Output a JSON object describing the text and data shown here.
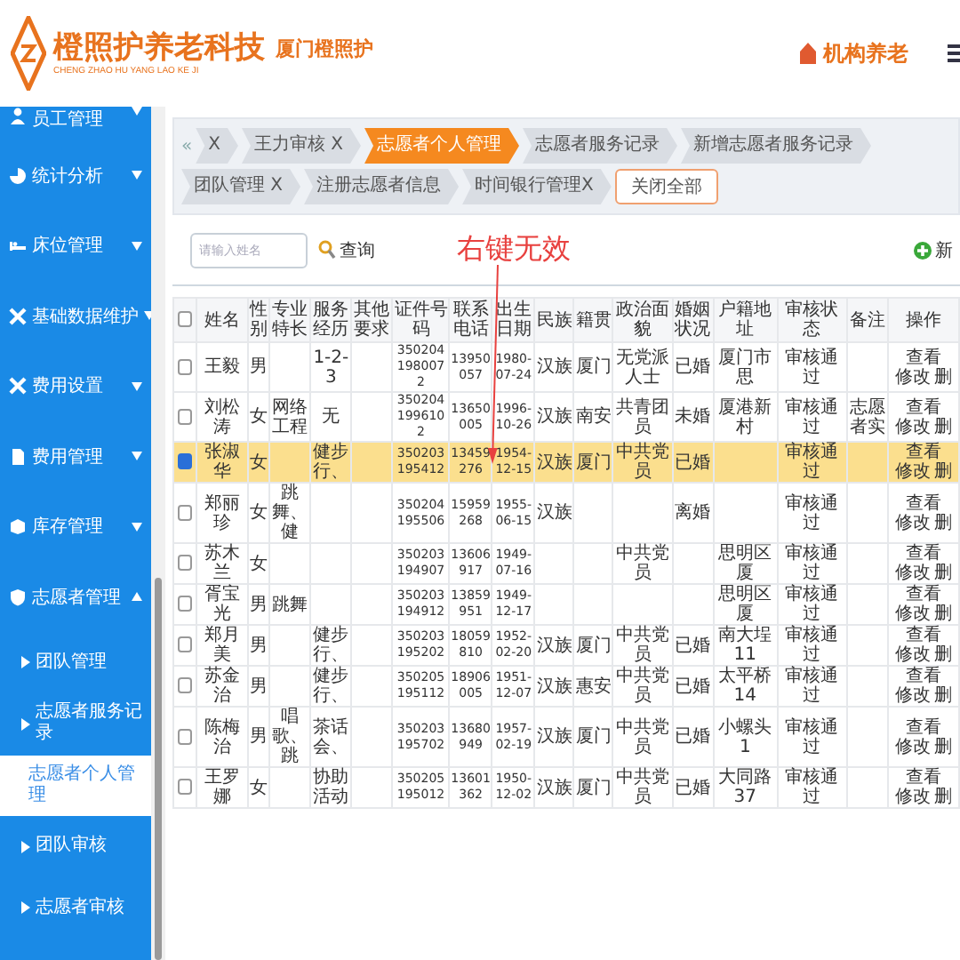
{
  "header": {
    "brand": "橙照护养老科技",
    "brand_pinyin": "CHENG ZHAO HU YANG LAO KE JI",
    "city": "厦门橙照护",
    "module": "机构养老"
  },
  "sidebar": {
    "items": [
      {
        "label": "员工管理",
        "expanded": false
      },
      {
        "label": "统计分析",
        "expanded": false
      },
      {
        "label": "床位管理",
        "expanded": false
      },
      {
        "label": "基础数据维护",
        "expanded": false
      },
      {
        "label": "费用设置",
        "expanded": false
      },
      {
        "label": "费用管理",
        "expanded": false
      },
      {
        "label": "库存管理",
        "expanded": false
      },
      {
        "label": "志愿者管理",
        "expanded": true,
        "children": [
          {
            "label": "团队管理",
            "selected": false
          },
          {
            "label": "志愿者服务记录",
            "selected": false
          },
          {
            "label": "志愿者个人管理",
            "selected": true
          },
          {
            "label": "团队审核",
            "selected": false
          },
          {
            "label": "志愿者审核",
            "selected": false
          }
        ]
      }
    ]
  },
  "tabs": [
    {
      "label": "X",
      "selected": false
    },
    {
      "label": "王力审核 X",
      "selected": false
    },
    {
      "label": "志愿者个人管理",
      "selected": true
    },
    {
      "label": "志愿者服务记录",
      "selected": false
    },
    {
      "label": "新增志愿者服务记录",
      "selected": false
    },
    {
      "label": "团队管理 X",
      "selected": false
    },
    {
      "label": "注册志愿者信息",
      "selected": false
    },
    {
      "label": "时间银行管理X",
      "selected": false
    }
  ],
  "tab_scroll": "«",
  "close_all": "关闭全部",
  "search": {
    "placeholder": "请输入姓名",
    "button": "查询"
  },
  "note": "右键无效",
  "add_button": "新",
  "table": {
    "select_all_checked": false,
    "columns": [
      "姓名",
      "性别",
      "专业特长",
      "服务经历",
      "其他要求",
      "证件号码",
      "联系电话",
      "出生日期",
      "民族",
      "籍贯",
      "政治面貌",
      "婚姻状况",
      "户籍地址",
      "审核状态",
      "备注",
      "操作"
    ],
    "rows": [
      {
        "checked": false,
        "selected": false,
        "cells": [
          "王毅",
          "男",
          "",
          "1-2-3",
          "",
          "3502041980072",
          "13950057",
          "1980-07-24",
          "汉族",
          "厦门",
          "无党派人士",
          "已婚",
          "厦门市思",
          "审核通过",
          ""
        ],
        "actions": [
          "查看",
          "修改",
          "删"
        ]
      },
      {
        "checked": false,
        "selected": false,
        "cells": [
          "刘松涛",
          "女",
          "网络工程",
          "无",
          "",
          "3502041996102",
          "13650005",
          "1996-10-26",
          "汉族",
          "南安",
          "共青团员",
          "未婚",
          "厦港新村",
          "审核通过",
          "志愿者实"
        ],
        "actions": [
          "查看",
          "修改",
          "删"
        ]
      },
      {
        "checked": true,
        "selected": true,
        "cells": [
          "张淑华",
          "女",
          "",
          "健步行、",
          "",
          "350203195412",
          "13459276",
          "1954-12-15",
          "汉族",
          "厦门",
          "中共党员",
          "已婚",
          "",
          "审核通过",
          ""
        ],
        "actions": [
          "查看",
          "修改",
          "删"
        ]
      },
      {
        "checked": false,
        "selected": false,
        "cells": [
          "郑丽珍",
          "女",
          "跳舞、健",
          "",
          "",
          "350204195506",
          "15959268",
          "1955-06-15",
          "汉族",
          "",
          "",
          "离婚",
          "",
          "审核通过",
          ""
        ],
        "actions": [
          "查看",
          "修改",
          "删"
        ]
      },
      {
        "checked": false,
        "selected": false,
        "cells": [
          "苏木兰",
          "女",
          "",
          "",
          "",
          "350203194907",
          "13606917",
          "1949-07-16",
          "",
          "",
          "中共党员",
          "",
          "思明区厦",
          "审核通过",
          ""
        ],
        "actions": [
          "查看",
          "修改",
          "删"
        ]
      },
      {
        "checked": false,
        "selected": false,
        "cells": [
          "胥宝光",
          "男",
          "跳舞",
          "",
          "",
          "350203194912",
          "13859951",
          "1949-12-17",
          "",
          "",
          "",
          "",
          "思明区厦",
          "审核通过",
          ""
        ],
        "actions": [
          "查看",
          "修改",
          "删"
        ]
      },
      {
        "checked": false,
        "selected": false,
        "cells": [
          "郑月美",
          "男",
          "",
          "健步行、",
          "",
          "350203195202",
          "18059810",
          "1952-02-20",
          "汉族",
          "厦门",
          "中共党员",
          "已婚",
          "南大埕11",
          "审核通过",
          ""
        ],
        "actions": [
          "查看",
          "修改",
          "删"
        ]
      },
      {
        "checked": false,
        "selected": false,
        "cells": [
          "苏金治",
          "男",
          "",
          "健步行、",
          "",
          "350205195112",
          "18906005",
          "1951-12-07",
          "汉族",
          "惠安",
          "中共党员",
          "已婚",
          "太平桥14",
          "审核通过",
          ""
        ],
        "actions": [
          "查看",
          "修改",
          "删"
        ]
      },
      {
        "checked": false,
        "selected": false,
        "cells": [
          "陈梅治",
          "男",
          "唱歌、跳",
          "茶话会、",
          "",
          "350203195702",
          "13680949",
          "1957-02-19",
          "汉族",
          "厦门",
          "中共党员",
          "已婚",
          "小螺头1",
          "审核通过",
          ""
        ],
        "actions": [
          "查看",
          "修改",
          "删"
        ]
      },
      {
        "checked": false,
        "selected": false,
        "cells": [
          "王罗娜",
          "女",
          "",
          "协助活动",
          "",
          "350205195012",
          "13601362",
          "1950-12-02",
          "汉族",
          "厦门",
          "中共党员",
          "已婚",
          "大同路37",
          "审核通过",
          ""
        ],
        "actions": [
          "查看",
          "修改",
          "删"
        ]
      }
    ]
  }
}
